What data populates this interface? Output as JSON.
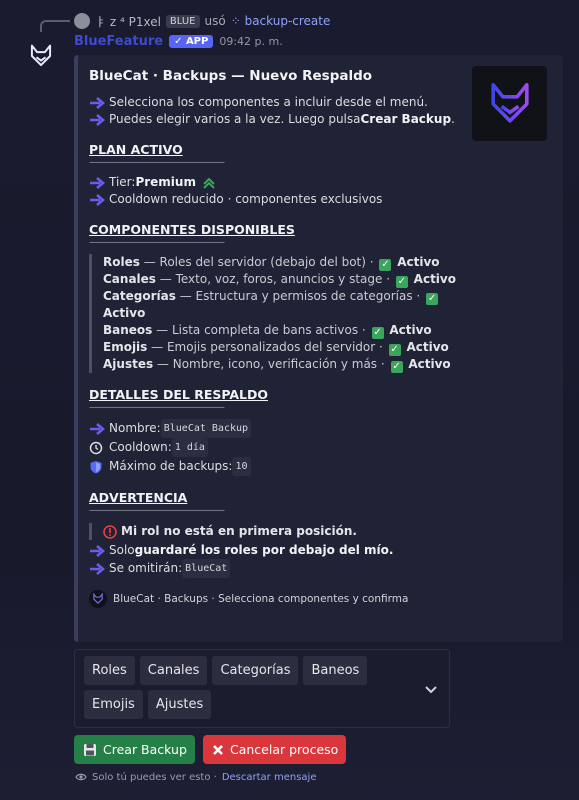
{
  "reply": {
    "username": "ㅑ z ⁴ P1xel",
    "badge": "BLUE",
    "used": "usó",
    "command": "backup-create"
  },
  "message": {
    "bot_name": "BlueFeature",
    "app_badge": "✓ APP",
    "timestamp": "09:42 p. m."
  },
  "embed": {
    "title": "BlueCat · Backups — Nuevo Respaldo",
    "intro": [
      "Selecciona los componentes a incluir desde el menú.",
      "Puedes elegir varios a la vez. Luego pulsa "
    ],
    "intro_bold": "Crear Backup",
    "divider": "———————————————",
    "plan": {
      "heading": "PLAN ACTIVO",
      "tier_label": "Tier: ",
      "tier_value": "Premium",
      "cooldown": "Cooldown reducido · componentes exclusivos"
    },
    "components": {
      "heading": "COMPONENTES DISPONIBLES",
      "status": "Activo",
      "items": [
        {
          "name": "Roles",
          "desc": " — Roles del servidor (debajo del bot) · "
        },
        {
          "name": "Canales",
          "desc": " — Texto, voz, foros, anuncios y stage · "
        },
        {
          "name": "Categorías",
          "desc": " — Estructura y permisos de categorías · "
        },
        {
          "name": "Baneos",
          "desc": " — Lista completa de bans activos · "
        },
        {
          "name": "Emojis",
          "desc": " — Emojis personalizados del servidor · "
        },
        {
          "name": "Ajustes",
          "desc": " — Nombre, icono, verificación y más · "
        }
      ]
    },
    "details": {
      "heading": "DETALLES DEL RESPALDO",
      "name_label": "Nombre: ",
      "name_value": "BlueCat Backup",
      "cooldown_label": "Cooldown: ",
      "cooldown_value": "1 día",
      "max_label": "Máximo de backups: ",
      "max_value": "10"
    },
    "warning": {
      "heading": "ADVERTENCIA",
      "alert": "Mi rol no está en primera posición.",
      "line1_prefix": "Solo ",
      "line1_bold": "guardaré los roles por debajo del mío.",
      "line2_label": "Se omitirán: ",
      "line2_value": "BlueCat"
    },
    "footer": "BlueCat  ·  Backups  ·  Selecciona componentes y confirma"
  },
  "select_menu": {
    "chips": [
      "Roles",
      "Canales",
      "Categorías",
      "Baneos",
      "Emojis",
      "Ajustes"
    ]
  },
  "buttons": {
    "create": "Crear Backup",
    "cancel": "Cancelar proceso"
  },
  "ephemeral": {
    "text": "Solo tú puedes ver esto · ",
    "dismiss": "Descartar mensaje"
  },
  "colors": {
    "accent": "#5865f2",
    "success": "#248046",
    "danger": "#da373c",
    "arrow": "#6b5cf0"
  }
}
